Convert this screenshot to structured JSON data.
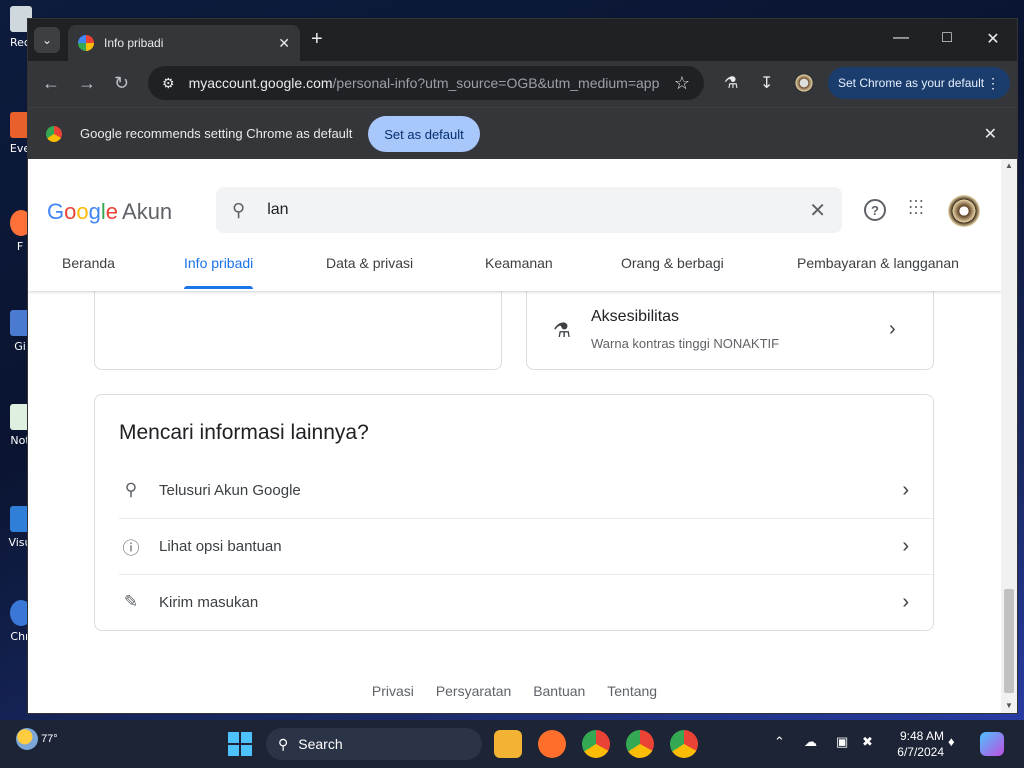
{
  "desktop": {
    "icons": [
      {
        "label": "Rec"
      },
      {
        "label": "Eve"
      },
      {
        "label": "F"
      },
      {
        "label": "Gi"
      },
      {
        "label": "Not"
      },
      {
        "label": "Visu"
      },
      {
        "label": "Chr"
      }
    ]
  },
  "browser": {
    "tab_title": "Info pribadi",
    "url_host": "myaccount.google.com",
    "url_path": "/personal-info?utm_source=OGB&utm_medium=app",
    "set_default_pill": "Set Chrome as your default",
    "infobar_message": "Google recommends setting Chrome as default",
    "infobar_button": "Set as default"
  },
  "header": {
    "logo_text": "Google",
    "logo_suffix": "Akun",
    "search_value": "lan"
  },
  "nav_tabs": [
    {
      "label": "Beranda",
      "active": false
    },
    {
      "label": "Info pribadi",
      "active": true
    },
    {
      "label": "Data & privasi",
      "active": false
    },
    {
      "label": "Keamanan",
      "active": false
    },
    {
      "label": "Orang & berbagi",
      "active": false
    },
    {
      "label": "Pembayaran & langganan",
      "active": false
    }
  ],
  "accessibility": {
    "title": "Aksesibilitas",
    "subtitle": "Warna kontras tinggi NONAKTIF"
  },
  "more_info": {
    "title": "Mencari informasi lainnya?",
    "rows": [
      {
        "label": "Telusuri Akun Google",
        "icon": "search-icon"
      },
      {
        "label": "Lihat opsi bantuan",
        "icon": "help-icon"
      },
      {
        "label": "Kirim masukan",
        "icon": "feedback-icon"
      }
    ]
  },
  "footer": {
    "links": [
      "Privasi",
      "Persyaratan",
      "Bantuan",
      "Tentang"
    ]
  },
  "taskbar": {
    "weather_temp": "77°",
    "search_label": "Search",
    "time": "9:48 AM",
    "date": "6/7/2024"
  }
}
